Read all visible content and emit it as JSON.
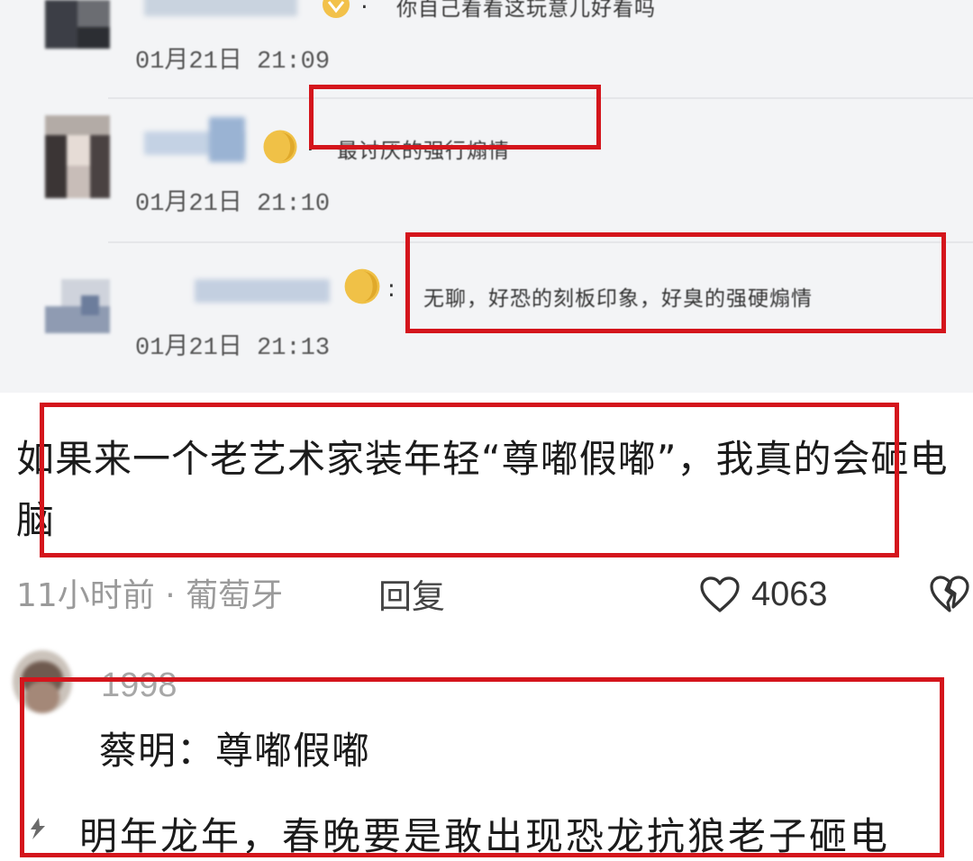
{
  "thread": {
    "replies": [
      {
        "text": "你自己看看这玩意儿好看吗",
        "timestamp": "01月21日 21:09"
      },
      {
        "text": "最讨厌的强行煽情",
        "timestamp": "01月21日 21:10"
      },
      {
        "text": "无聊，好恐的刻板印象，好臭的强硬煽情",
        "timestamp": "01月21日 21:13"
      }
    ],
    "colon": ":"
  },
  "comment": {
    "text": "如果来一个老艺术家装年轻“尊嘟假嘟”，我真的会砸电脑",
    "meta": "11小时前 · 葡萄牙",
    "reply_label": "回复",
    "likes": "4063"
  },
  "sub_reply": {
    "username": "1998",
    "text": "蔡明：尊嘟假嘟",
    "next_line": "明年龙年，春晚要是敢出现恐龙抗狼老子砸电"
  },
  "colors": {
    "annotation_red": "#d4151c",
    "thread_bg": "#f3f4f6",
    "meta_gray": "#9a9a9a"
  },
  "icons": {
    "like": "heart-outline-icon",
    "dislike": "broken-heart-icon",
    "badge": "gold-badge-icon"
  }
}
